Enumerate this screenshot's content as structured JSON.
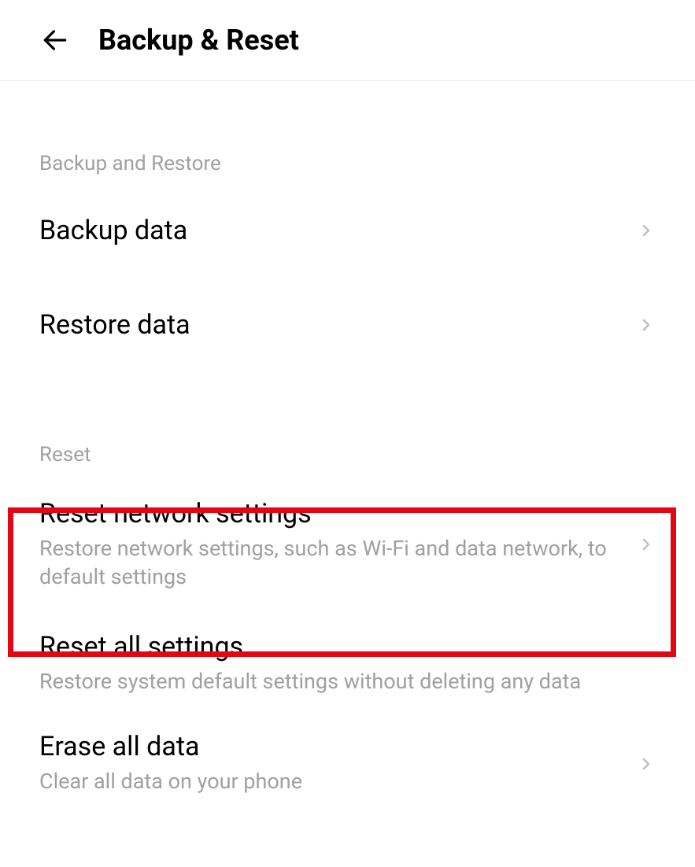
{
  "header": {
    "title": "Backup & Reset"
  },
  "sections": {
    "backup_restore": {
      "header": "Backup and Restore",
      "items": {
        "backup_data": {
          "title": "Backup data"
        },
        "restore_data": {
          "title": "Restore data"
        }
      }
    },
    "reset": {
      "header": "Reset",
      "items": {
        "reset_network": {
          "title": "Reset network settings",
          "subtitle": "Restore network settings, such as Wi-Fi and data network, to default settings"
        },
        "reset_all": {
          "title": "Reset all settings",
          "subtitle": "Restore system default settings without deleting any data"
        },
        "erase_all": {
          "title": "Erase all data",
          "subtitle": "Clear all data on your phone"
        }
      }
    }
  }
}
